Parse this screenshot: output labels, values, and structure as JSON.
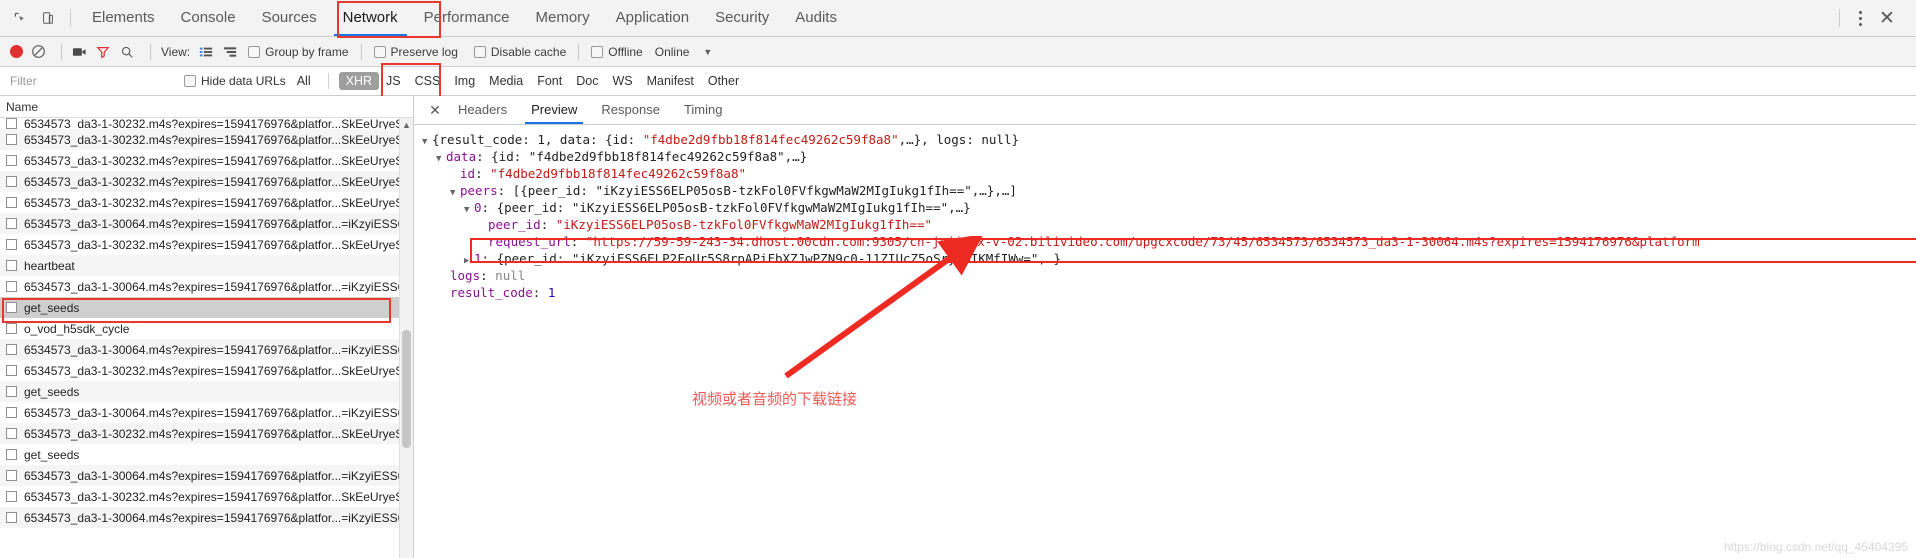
{
  "window": {
    "tabs": [
      {
        "label": "Elements",
        "active": false
      },
      {
        "label": "Console",
        "active": false
      },
      {
        "label": "Sources",
        "active": false
      },
      {
        "label": "Network",
        "active": true
      },
      {
        "label": "Performance",
        "active": false
      },
      {
        "label": "Memory",
        "active": false
      },
      {
        "label": "Application",
        "active": false
      },
      {
        "label": "Security",
        "active": false
      },
      {
        "label": "Audits",
        "active": false
      }
    ],
    "inspect_icon": "inspect-element-icon",
    "device_icon": "device-toolbar-icon",
    "menu_icon": "kebab-menu-icon",
    "close_icon": "close-icon"
  },
  "toolbar": {
    "record_icon": "record-circle-icon",
    "clear_icon": "clear-prohibited-icon",
    "capture_icon": "camera-icon",
    "filter_icon": "funnel-icon",
    "search_icon": "search-icon",
    "view_label": "View:",
    "view_list_icon": "list-view-icon",
    "view_waterfall_icon": "waterfall-view-icon",
    "group_by_frame": "Group by frame",
    "preserve_log": "Preserve log",
    "disable_cache": "Disable cache",
    "offline": "Offline",
    "throttle_value": "Online",
    "throttle_caret": "chevron-down-icon"
  },
  "filterbar": {
    "placeholder": "Filter",
    "value": "",
    "hide_data_urls": "Hide data URLs",
    "types": [
      {
        "label": "All",
        "selected": false
      },
      {
        "label": "XHR",
        "selected": true
      },
      {
        "label": "JS",
        "selected": false
      },
      {
        "label": "CSS",
        "selected": false
      },
      {
        "label": "Img",
        "selected": false
      },
      {
        "label": "Media",
        "selected": false
      },
      {
        "label": "Font",
        "selected": false
      },
      {
        "label": "Doc",
        "selected": false
      },
      {
        "label": "WS",
        "selected": false
      },
      {
        "label": "Manifest",
        "selected": false
      },
      {
        "label": "Other",
        "selected": false
      }
    ]
  },
  "requests": {
    "column_header": "Name",
    "rows": [
      {
        "name": "6534573_da3-1-30232.m4s?expires=1594176976&platfor...SkEeUryeS",
        "selected": false,
        "clipped": true
      },
      {
        "name": "6534573_da3-1-30232.m4s?expires=1594176976&platfor...SkEeUryeS",
        "selected": false
      },
      {
        "name": "6534573_da3-1-30232.m4s?expires=1594176976&platfor...SkEeUryeS",
        "selected": false
      },
      {
        "name": "6534573_da3-1-30232.m4s?expires=1594176976&platfor...SkEeUryeS",
        "selected": false
      },
      {
        "name": "6534573_da3-1-30232.m4s?expires=1594176976&platfor...SkEeUryeS",
        "selected": false
      },
      {
        "name": "6534573_da3-1-30064.m4s?expires=1594176976&platfor...=iKzyiESS6",
        "selected": false
      },
      {
        "name": "6534573_da3-1-30232.m4s?expires=1594176976&platfor...SkEeUryeS",
        "selected": false
      },
      {
        "name": "heartbeat",
        "selected": false
      },
      {
        "name": "6534573_da3-1-30064.m4s?expires=1594176976&platfor...=iKzyiESS6",
        "selected": false
      },
      {
        "name": "get_seeds",
        "selected": true
      },
      {
        "name": "o_vod_h5sdk_cycle",
        "selected": false
      },
      {
        "name": "6534573_da3-1-30064.m4s?expires=1594176976&platfor...=iKzyiESS6",
        "selected": false
      },
      {
        "name": "6534573_da3-1-30232.m4s?expires=1594176976&platfor...SkEeUryeS",
        "selected": false
      },
      {
        "name": "get_seeds",
        "selected": false
      },
      {
        "name": "6534573_da3-1-30064.m4s?expires=1594176976&platfor...=iKzyiESS6",
        "selected": false
      },
      {
        "name": "6534573_da3-1-30232.m4s?expires=1594176976&platfor...SkEeUryeS",
        "selected": false
      },
      {
        "name": "get_seeds",
        "selected": false
      },
      {
        "name": "6534573_da3-1-30064.m4s?expires=1594176976&platfor...=iKzyiESS6",
        "selected": false
      },
      {
        "name": "6534573_da3-1-30232.m4s?expires=1594176976&platfor...SkEeUryeS",
        "selected": false
      },
      {
        "name": "6534573_da3-1-30064.m4s?expires=1594176976&platfor...=iKzyiESS6",
        "selected": false
      }
    ]
  },
  "detail": {
    "close_icon": "close-icon",
    "tabs": [
      {
        "label": "Headers",
        "active": false
      },
      {
        "label": "Preview",
        "active": true
      },
      {
        "label": "Response",
        "active": false
      },
      {
        "label": "Timing",
        "active": false
      }
    ],
    "preview": {
      "line1_prefix": "{result_code: 1, data: {id: ",
      "line1_id": "\"f4dbe2d9fbb18f814fec49262c59f8a8\"",
      "line1_suffix": ",…}, logs: null}",
      "line2_key": "data",
      "line2_text": ": {id: \"f4dbe2d9fbb18f814fec49262c59f8a8\",…}",
      "line3_key": "id",
      "line3_value": "\"f4dbe2d9fbb18f814fec49262c59f8a8\"",
      "line4_key": "peers",
      "line4_text": ": [{peer_id: \"iKzyiESS6ELP05osB-tzkFol0FVfkgwMaW2MIgIukg1fIh==\",…},…]",
      "line5_key": "0",
      "line5_text": ": {peer_id: \"iKzyiESS6ELP05osB-tzkFol0FVfkgwMaW2MIgIukg1fIh==\",…}",
      "line6_key": "peer_id",
      "line6_value": "\"iKzyiESS6ELP05osB-tzkFol0FVfkgwMaW2MIgIukg1fIh==\"",
      "line7_key": "request_url",
      "line7_value": "\"https://59-59-243-34.dhost.00cdn.com:9305/cn-jxjj-dx-v-02.bilivideo.com/upgcxcode/73/45/6534573/6534573_da3-1-30064.m4s?expires=1594176976&platform",
      "line8_key": "1",
      "line8_text": ": {peer_id: \"iKzyiESS6ELP2FoUr5S8rpAPiFbXZJwPZN9c0-11ZIUcZ5oSryu4IKMfIWw=\",…}",
      "line9_key": "logs",
      "line9_value": "null",
      "line10_key": "result_code",
      "line10_value": "1"
    }
  },
  "annotations": {
    "chinese_note": "视频或者音频的下载链接",
    "arrow": "red-arrow-pointing-up-right",
    "box_color": "#ee2b22"
  },
  "watermark": "https://blog.csdn.net/qq_45404395"
}
